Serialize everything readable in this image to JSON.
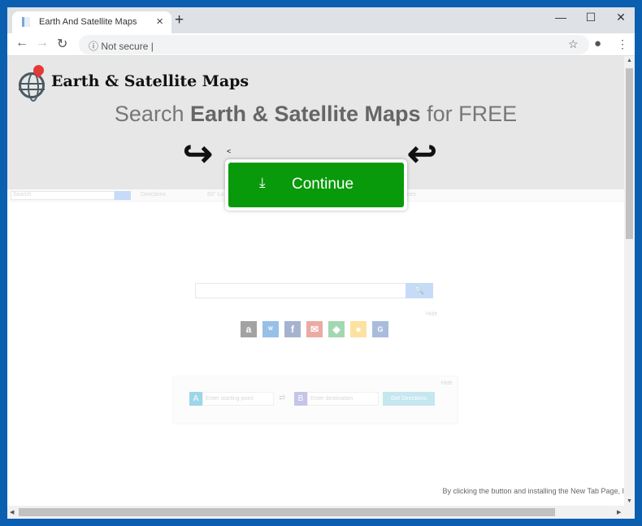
{
  "browser": {
    "tab_title": "Earth And Satellite Maps",
    "address": "Not secure",
    "window_color": "#0b5fb0"
  },
  "page": {
    "logo_text": "Earth & Satellite Maps",
    "headline_pre": "Search ",
    "headline_bold": "Earth & Satellite Maps",
    "headline_post": " for FREE",
    "stray_char": "<",
    "continue_label": "Continue",
    "continue_color": "#089a0a",
    "bg_bar": {
      "search_placeholder": "Search",
      "directions": "Directions",
      "weather": "83° Lo",
      "other": "ces"
    },
    "search_hide": "Hide",
    "shortcuts": [
      "amazon",
      "walmart",
      "facebook",
      "gmail",
      "google-maps",
      "maps",
      "gs"
    ],
    "directions": {
      "hide": "Hide",
      "a": "A",
      "b": "B",
      "start_placeholder": "Enter starting point",
      "dest_placeholder": "Enter destination",
      "button": "Get Directions"
    },
    "footer": "By clicking the button and installing the New Tab Page, I"
  }
}
